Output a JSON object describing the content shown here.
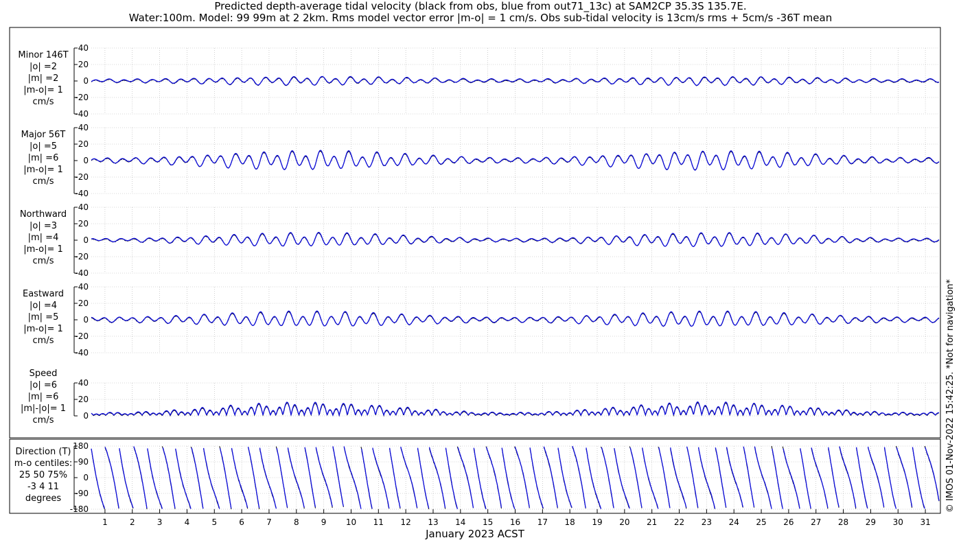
{
  "title_line1": "Predicted depth-average tidal velocity (black from obs, blue from out71_13c) at SAM2CP 35.3S 135.7E.",
  "title_line2": "Water:100m. Model: 99 99m at 2 2km. Rms model vector error |m-o| = 1 cm/s. Obs sub-tidal velocity is 13cm/s rms + 5cm/s -36T mean",
  "x_axis_label": "January 2023 ACST",
  "credit": "© IMOS 01-Nov-2022 15:42:25. *Not for navigation*",
  "colors": {
    "obs": "#000000",
    "model": "#1010e0",
    "grid": "#b0b0b0"
  },
  "chart_data": [
    {
      "type": "line",
      "name": "minor",
      "label_lines": [
        "Minor 146T",
        "|o| =2",
        "|m| =2",
        "|m-o|= 1",
        "cm/s"
      ],
      "ylim": [
        -40,
        40
      ],
      "yticks": [
        40,
        20,
        0,
        -20,
        -40
      ],
      "x_range_days": [
        0.5,
        31.5
      ],
      "amplitude_envelope": [
        2,
        5
      ],
      "series": [
        {
          "name": "obs"
        },
        {
          "name": "model"
        }
      ]
    },
    {
      "type": "line",
      "name": "major",
      "label_lines": [
        "Major 56T",
        "|o| =5",
        "|m| =6",
        "|m-o|= 1",
        "cm/s"
      ],
      "ylim": [
        -40,
        40
      ],
      "yticks": [
        40,
        20,
        0,
        -20,
        -40
      ],
      "x_range_days": [
        0.5,
        31.5
      ],
      "amplitude_envelope": [
        3,
        11
      ],
      "series": [
        {
          "name": "obs"
        },
        {
          "name": "model"
        }
      ]
    },
    {
      "type": "line",
      "name": "northward",
      "label_lines": [
        "Northward",
        "|o| =3",
        "|m| =4",
        "|m-o|= 1",
        "cm/s"
      ],
      "ylim": [
        -40,
        40
      ],
      "yticks": [
        40,
        20,
        0,
        -20,
        -40
      ],
      "x_range_days": [
        0.5,
        31.5
      ],
      "amplitude_envelope": [
        2,
        8
      ],
      "series": [
        {
          "name": "obs"
        },
        {
          "name": "model"
        }
      ]
    },
    {
      "type": "line",
      "name": "eastward",
      "label_lines": [
        "Eastward",
        "|o| =4",
        "|m| =5",
        "|m-o|= 1",
        "cm/s"
      ],
      "ylim": [
        -40,
        40
      ],
      "yticks": [
        40,
        20,
        0,
        -20,
        -40
      ],
      "x_range_days": [
        0.5,
        31.5
      ],
      "amplitude_envelope": [
        3,
        9
      ],
      "series": [
        {
          "name": "obs"
        },
        {
          "name": "model"
        }
      ]
    },
    {
      "type": "line",
      "name": "speed",
      "label_lines": [
        "Speed",
        "|o| =6",
        "|m| =6",
        "|m|-|o|= 1",
        "cm/s"
      ],
      "ylim": [
        0,
        40
      ],
      "yticks": [
        40,
        20,
        0
      ],
      "x_range_days": [
        0.5,
        31.5
      ],
      "amplitude_envelope": [
        3,
        14
      ],
      "series": [
        {
          "name": "obs"
        },
        {
          "name": "model"
        }
      ]
    },
    {
      "type": "line",
      "name": "direction",
      "label_lines": [
        "Direction (T)",
        "m-o centiles:",
        "25  50  75%",
        "-3   4  11",
        "degrees"
      ],
      "ylim": [
        -180,
        180
      ],
      "yticks": [
        180,
        90,
        0,
        -90,
        -180
      ],
      "x_range_days": [
        0.5,
        31.5
      ],
      "series": [
        {
          "name": "obs"
        },
        {
          "name": "model"
        }
      ]
    }
  ],
  "x_ticks": [
    "1",
    "2",
    "3",
    "4",
    "5",
    "6",
    "7",
    "8",
    "9",
    "10",
    "11",
    "12",
    "13",
    "14",
    "15",
    "16",
    "17",
    "18",
    "19",
    "20",
    "21",
    "22",
    "23",
    "24",
    "25",
    "26",
    "27",
    "28",
    "29",
    "30",
    "31"
  ]
}
